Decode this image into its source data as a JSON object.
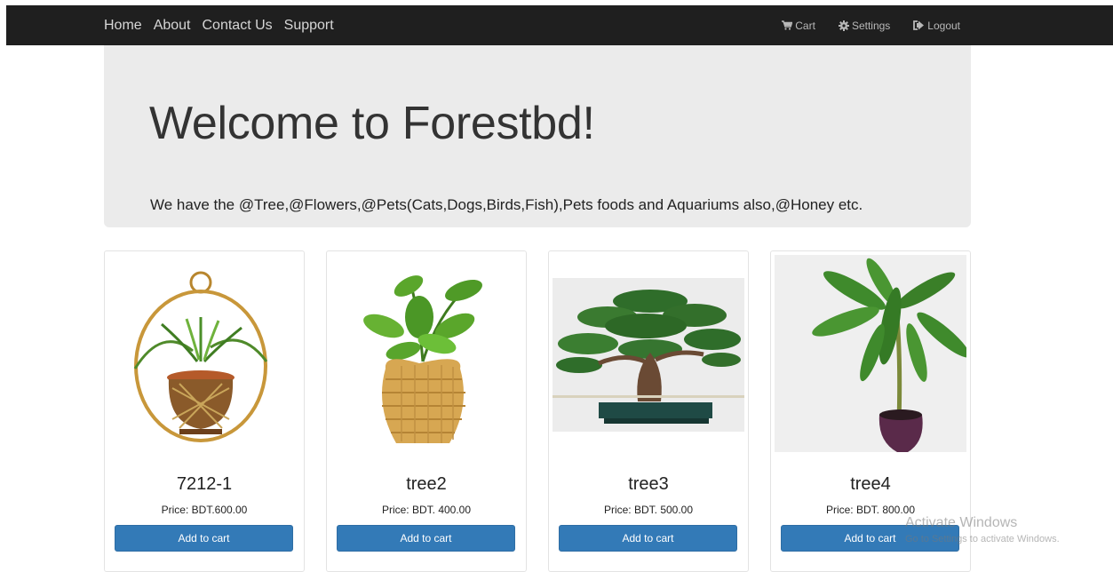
{
  "nav": {
    "left_links": [
      "Home",
      "About",
      "Contact Us",
      "Support"
    ],
    "cart_label": "Cart",
    "settings_label": "Settings",
    "logout_label": "Logout"
  },
  "hero": {
    "title": "Welcome to Forestbd!",
    "subtitle": "We have the @Tree,@Flowers,@Pets(Cats,Dogs,Birds,Fish),Pets foods and Aquariums also,@Honey etc."
  },
  "products": [
    {
      "name": "7212-1",
      "price": "Price: BDT.600.00",
      "button": "Add to cart",
      "image": "plant-hanging-basket"
    },
    {
      "name": "tree2",
      "price": "Price: BDT. 400.00",
      "button": "Add to cart",
      "image": "plant-wicker-pot"
    },
    {
      "name": "tree3",
      "price": "Price: BDT. 500.00",
      "button": "Add to cart",
      "image": "bonsai-tree"
    },
    {
      "name": "tree4",
      "price": "Price: BDT. 800.00",
      "button": "Add to cart",
      "image": "money-tree-pot"
    }
  ],
  "watermark": {
    "line1": "Activate Windows",
    "line2": "Go to Settings to activate Windows."
  },
  "colors": {
    "navbar": "#1f1f1f",
    "jumbotron": "#ebebeb",
    "button": "#337ab7"
  }
}
